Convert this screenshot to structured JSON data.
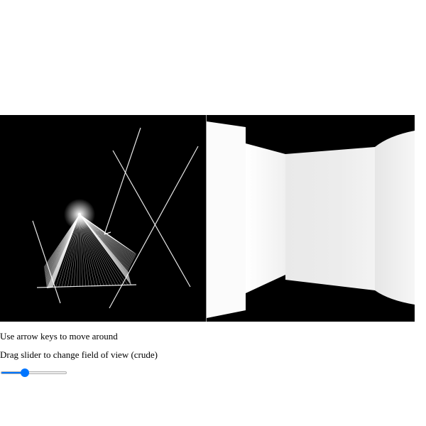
{
  "instructions": {
    "keys_text": "Use arrow keys to move around",
    "fov_text": "Drag slider to change field of view (crude)"
  },
  "fov_slider": {
    "min": 0,
    "max": 100,
    "value": 35,
    "accent_color": "#0075ff"
  },
  "colors": {
    "scene_background": "#000000",
    "wall_line": "#ffffff",
    "ray": "#ffffff"
  }
}
